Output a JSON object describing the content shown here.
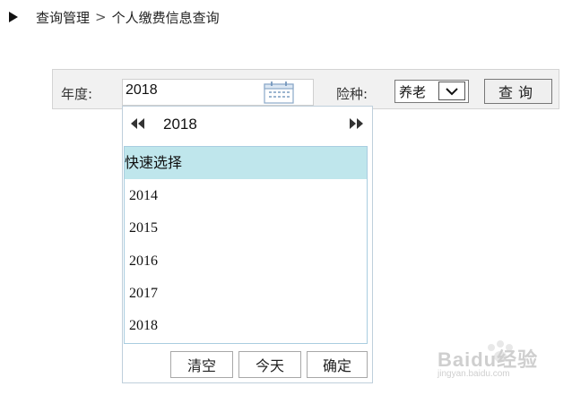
{
  "breadcrumb": {
    "parent": "查询管理",
    "separator": ">",
    "current": "个人缴费信息查询"
  },
  "search": {
    "year_label": "年度:",
    "year_value": "2018",
    "insurance_label": "险种:",
    "insurance_value": "养老",
    "query_button": "查询"
  },
  "year_picker": {
    "current_year": "2018",
    "quick_select_label": "快速选择",
    "years": [
      "2014",
      "2015",
      "2016",
      "2017",
      "2018"
    ],
    "buttons": {
      "clear": "清空",
      "today": "今天",
      "confirm": "确定"
    }
  },
  "watermark": {
    "title": "Baidu经验",
    "subtitle": "jingyan.baidu.com"
  },
  "colors": {
    "highlight": "#bfe6ec",
    "bar_background": "#f1f1f1",
    "list_border": "#a9cde0"
  }
}
